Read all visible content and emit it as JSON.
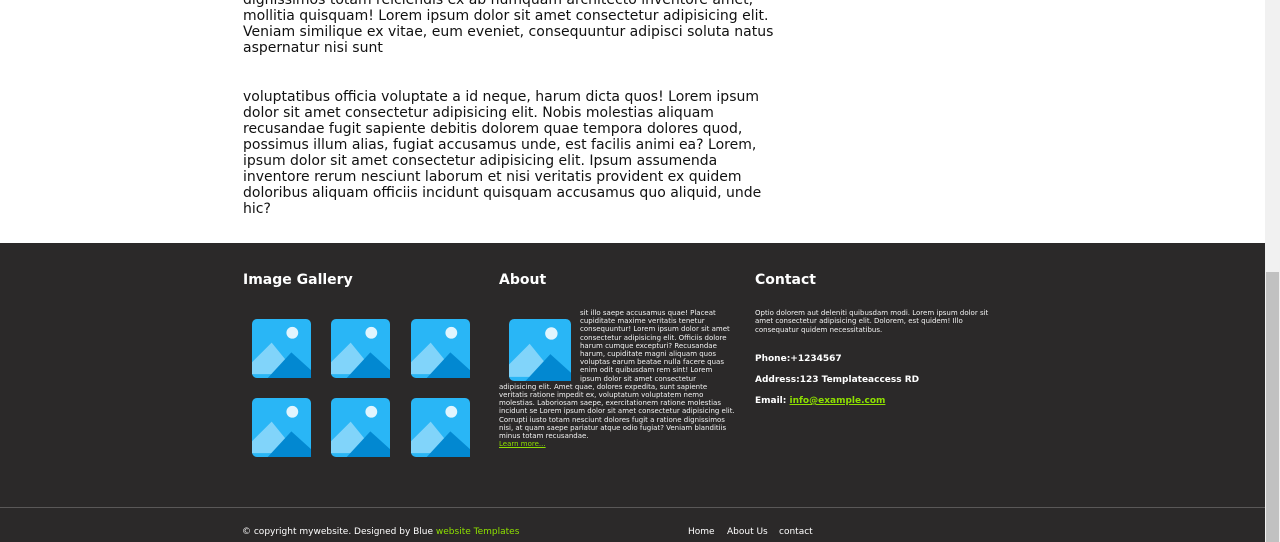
{
  "article": {
    "paragraph_1": "dignissimos totam reiciendis ex ab numquam architecto inventore amet, mollitia quisquam! Lorem ipsum dolor sit amet consectetur adipisicing elit. Veniam similique ex vitae, eum eveniet, consequuntur adipisci soluta natus aspernatur nisi sunt",
    "paragraph_2": "voluptatibus officia voluptate a id neque, harum dicta quos! Lorem ipsum dolor sit amet consectetur adipisicing elit. Nobis molestias aliquam recusandae fugit sapiente debitis dolorem quae tempora dolores quod, possimus illum alias, fugiat accusamus unde, est facilis animi ea? Lorem, ipsum dolor sit amet consectetur adipisicing elit. Ipsum assumenda inventore rerum nesciunt laborum et nisi veritatis provident ex quidem doloribus aliquam officiis incidunt quisquam accusamus quo aliquid, unde hic?"
  },
  "footer": {
    "gallery_title": "Image Gallery",
    "gallery_icon": "image-placeholder-icon",
    "about_title": "About",
    "about_text": "sit illo saepe accusamus quae! Placeat cupiditate maxime veritatis tenetur consequuntur! Lorem ipsum dolor sit amet consectetur adipisicing elit. Officiis dolore harum cumque excepturi? Recusandae harum, cupiditate magni aliquam quos voluptas earum beatae nulla facere quas enim odit quibusdam rem sint! Lorem ipsum dolor sit amet consectetur adipisicing elit. Amet quae, dolores expedita, sunt sapiente veritatis ratione impedit ex, voluptatum voluptatem nemo molestias. Laboriosam saepe, exercitationem ratione molestias incidunt se Lorem ipsum dolor sit amet consectetur adipisicing elit. Corrupti iusto totam nesciunt dolores fugit a ratione dignissimos nisi, at quam saepe pariatur atque odio fugiat? Veniam blanditiis minus totam recusandae.",
    "learn_more": "Learn more...",
    "contact_title": "Contact",
    "contact_desc": "Optio dolorem aut deleniti quibusdam modi. Lorem ipsum dolor sit amet consectetur adipisicing elit. Dolorem, est quidem! Illo consequatur quidem necessitatibus.",
    "phone": "Phone:+1234567",
    "address": "Address:123 Templateaccess RD",
    "email_label": "Email: ",
    "email_link": "info@example.com",
    "copyright_prefix": "© copyright mywebsite. Designed by Blue ",
    "copyright_link": "website Templates",
    "nav": [
      "Home",
      "About Us",
      "contact"
    ]
  },
  "colors": {
    "footer_bg": "#2b2929",
    "accent_green": "#8ee000",
    "image_blue": "#29b6f6"
  }
}
